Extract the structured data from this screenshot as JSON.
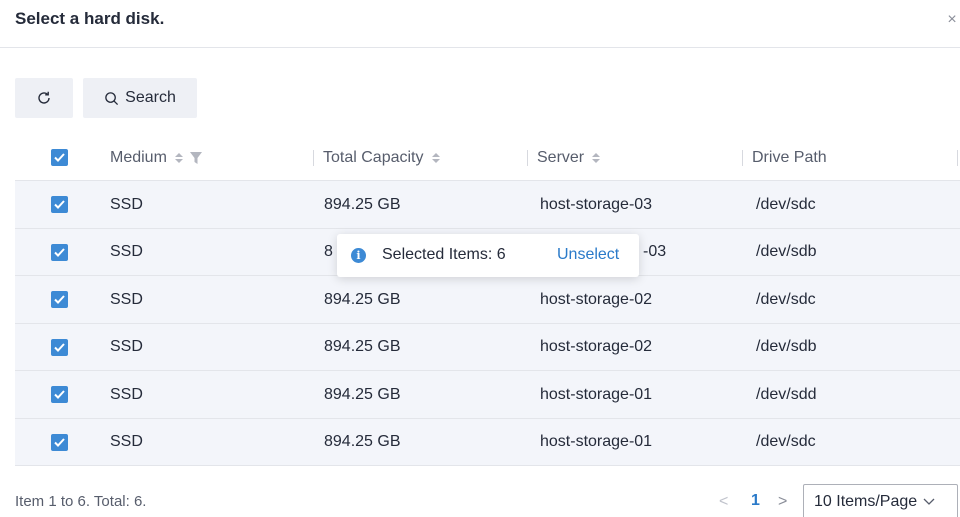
{
  "dialog": {
    "title": "Select a hard disk.",
    "close_glyph": "×"
  },
  "toolbar": {
    "refresh_icon": "refresh-icon",
    "search_label": "Search"
  },
  "table": {
    "columns": {
      "medium": "Medium",
      "total_capacity": "Total Capacity",
      "server": "Server",
      "drive_path": "Drive Path"
    },
    "rows": [
      {
        "medium": "SSD",
        "capacity": "894.25 GB",
        "server": "host-storage-03",
        "path": "/dev/sdc",
        "checked": true
      },
      {
        "medium": "SSD",
        "capacity": "8",
        "server": "-03",
        "path": "/dev/sdb",
        "checked": true
      },
      {
        "medium": "SSD",
        "capacity": "894.25 GB",
        "server": "host-storage-02",
        "path": "/dev/sdc",
        "checked": true
      },
      {
        "medium": "SSD",
        "capacity": "894.25 GB",
        "server": "host-storage-02",
        "path": "/dev/sdb",
        "checked": true
      },
      {
        "medium": "SSD",
        "capacity": "894.25 GB",
        "server": "host-storage-01",
        "path": "/dev/sdd",
        "checked": true
      },
      {
        "medium": "SSD",
        "capacity": "894.25 GB",
        "server": "host-storage-01",
        "path": "/dev/sdc",
        "checked": true
      }
    ]
  },
  "toast": {
    "text": "Selected Items: 6",
    "action": "Unselect"
  },
  "footer": {
    "info": "Item 1 to 6. Total: 6.",
    "prev": "<",
    "current_page": "1",
    "next": ">",
    "page_size": "10 Items/Page"
  },
  "colors": {
    "accent": "#3d8ad5",
    "link": "#2a7ac9",
    "row_bg": "#f3f5fa"
  }
}
